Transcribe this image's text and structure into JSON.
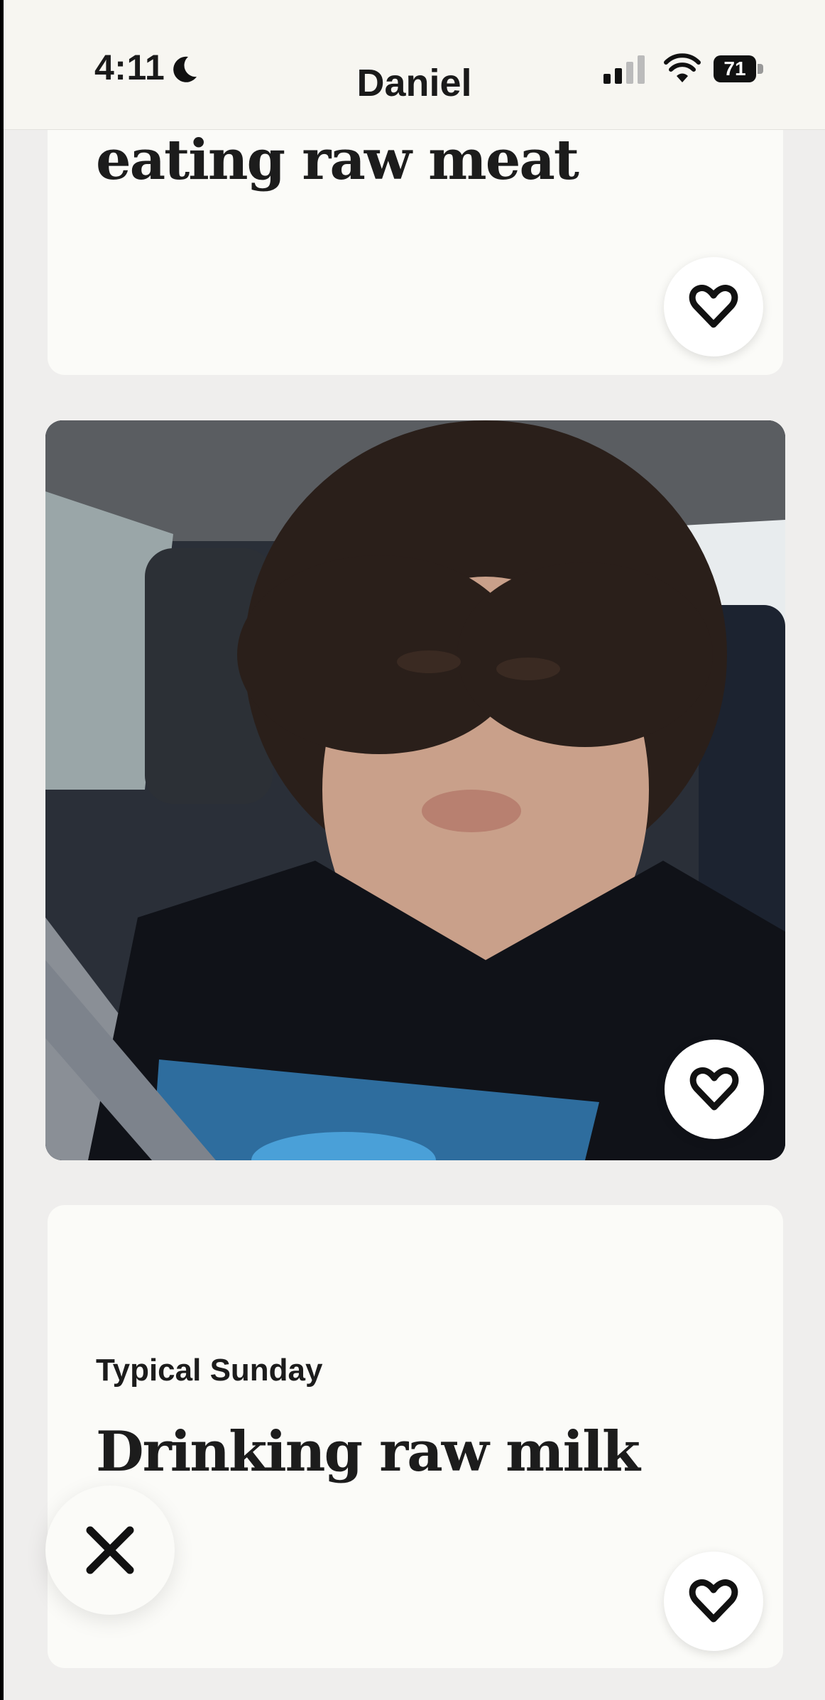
{
  "status_bar": {
    "time": "4:11",
    "battery": "71"
  },
  "header": {
    "title": "Daniel"
  },
  "cards": [
    {
      "answer": "eating raw meat"
    },
    {
      "type": "photo",
      "description_icon": "photo"
    },
    {
      "prompt": "Typical Sunday",
      "answer": "Drinking raw milk"
    }
  ],
  "icons": {
    "like": "heart-icon",
    "pass": "close-icon",
    "moon": "moon-icon",
    "signal": "signal-icon",
    "wifi": "wifi-icon",
    "battery": "battery-icon"
  },
  "colors": {
    "background": "#efeeed",
    "card": "#fbfbf8",
    "text": "#1c1c1c"
  }
}
